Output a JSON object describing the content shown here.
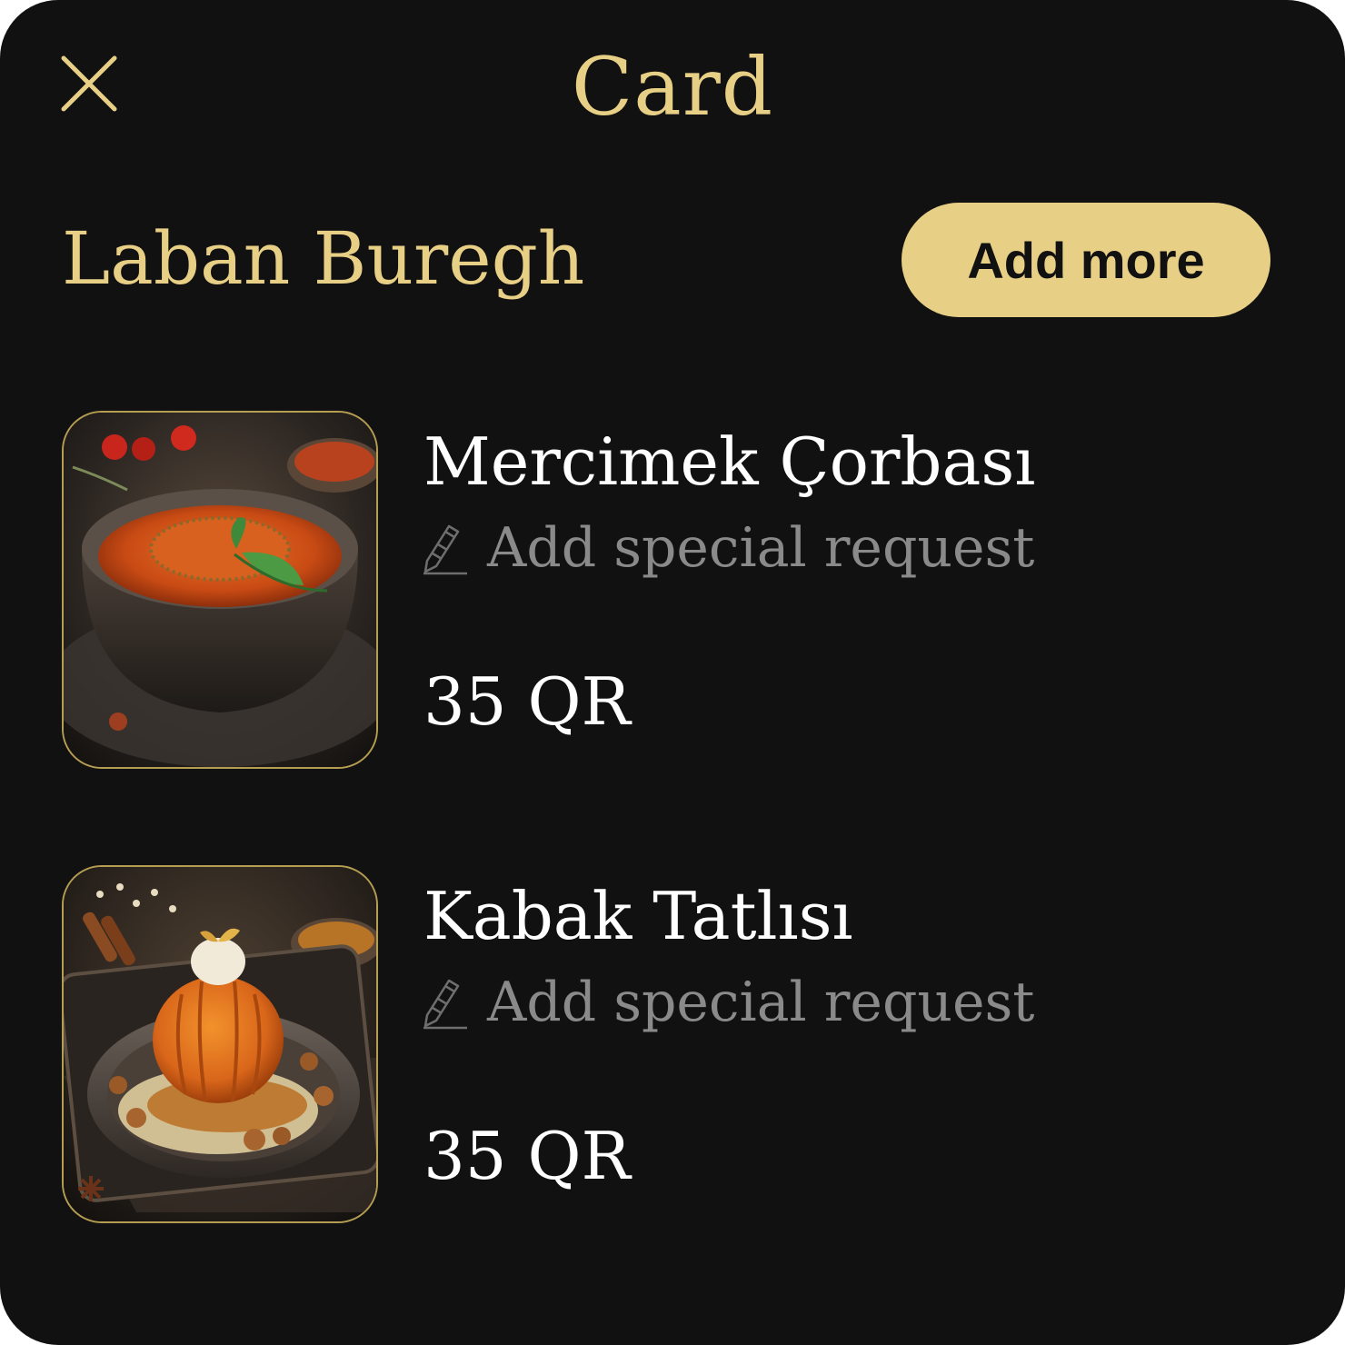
{
  "header": {
    "title": "Card",
    "close_icon": "close-icon"
  },
  "restaurant": {
    "name": "Laban Buregh",
    "add_more_label": "Add more"
  },
  "items": [
    {
      "name": "Mercimek Çorbası",
      "request_label": "Add special request",
      "request_icon": "pencil-icon",
      "price": "35 QR",
      "image": "lentil-soup-image"
    },
    {
      "name": "Kabak Tatlısı",
      "request_label": "Add special request",
      "request_icon": "pencil-icon",
      "price": "35 QR",
      "image": "pumpkin-dessert-image"
    }
  ],
  "colors": {
    "background": "#111111",
    "accent": "#e8cf86",
    "text_primary": "#ffffff",
    "text_muted": "#8a8a8a"
  }
}
